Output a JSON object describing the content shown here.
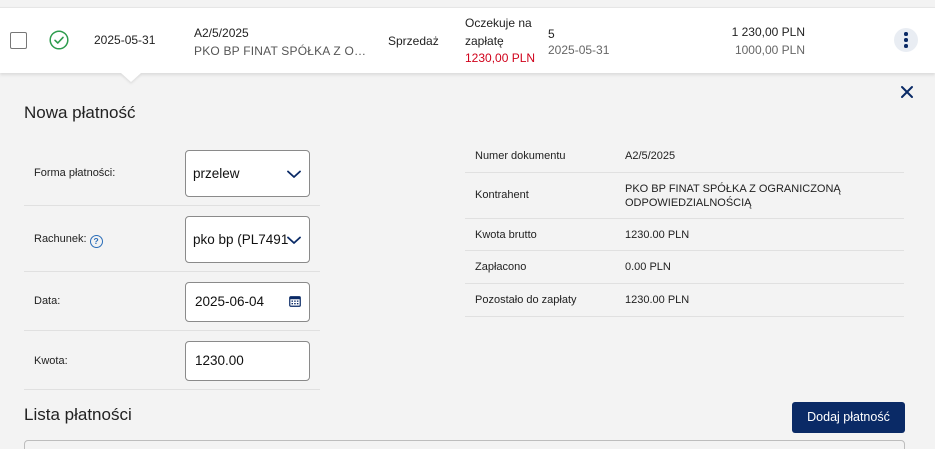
{
  "row": {
    "date": "2025-05-31",
    "doc_number": "A2/5/2025",
    "party": "PKO BP FINAT SPÓŁKA Z OGRANICZONĄ ODPOWIEDZIALNOŚCIĄ",
    "type": "Sprzedaż",
    "status_line1": "Oczekuje na",
    "status_line2": "zapłatę",
    "status_amount": "1230,00 PLN",
    "days": "5",
    "due_date": "2025-05-31",
    "amount_gross": "1 230,00 PLN",
    "amount_net": "1000,00 PLN"
  },
  "form": {
    "title": "Nowa płatność",
    "payment_method_label": "Forma płatności:",
    "payment_method_value": "przelew",
    "account_label": "Rachunek:",
    "account_value": "pko bp (PL7491",
    "date_label": "Data:",
    "date_value": "2025-06-04",
    "amount_label": "Kwota:",
    "amount_value": "1230.00"
  },
  "info": {
    "doc_number_label": "Numer dokumentu",
    "doc_number_value": "A2/5/2025",
    "party_label": "Kontrahent",
    "party_value_line1": "PKO BP FINAT SPÓŁKA Z OGRANICZONĄ",
    "party_value_line2": "ODPOWIEDZIALNOŚCIĄ",
    "gross_label": "Kwota brutto",
    "gross_value": "1230.00 PLN",
    "paid_label": "Zapłacono",
    "paid_value": "0.00 PLN",
    "remaining_label": "Pozostało do zapłaty",
    "remaining_value": "1230.00 PLN"
  },
  "payments": {
    "title": "Lista płatności",
    "add_button": "Dodaj płatność"
  },
  "icons": {
    "status": "check-circle-icon",
    "menu": "kebab-menu-icon",
    "close": "close-icon",
    "help": "help-icon",
    "calendar": "calendar-icon",
    "dropdown": "chevron-down-icon"
  },
  "colors": {
    "primary": "#0a2a66",
    "success": "#2e9c4e",
    "alert": "#d0021b",
    "help": "#2a6db8"
  }
}
